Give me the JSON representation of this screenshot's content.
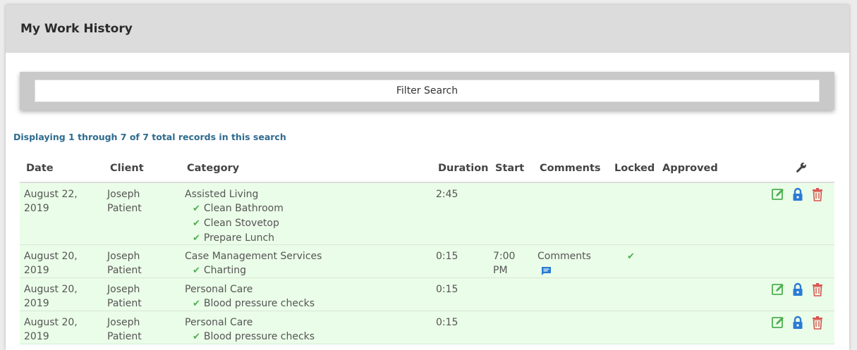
{
  "header": {
    "title": "My Work History"
  },
  "filter": {
    "label": "Filter Search"
  },
  "records_info": "Displaying 1 through 7 of 7 total records in this search",
  "columns": {
    "date": "Date",
    "client": "Client",
    "category": "Category",
    "duration": "Duration",
    "start": "Start",
    "comments": "Comments",
    "locked": "Locked",
    "approved": "Approved",
    "tools_icon": "wrench-icon"
  },
  "rows": [
    {
      "date_line1": "August 22,",
      "date_line2": "2019",
      "client_line1": "Joseph",
      "client_line2": "Patient",
      "category": "Assisted Living",
      "subitems": [
        "Clean Bathroom",
        "Clean Stovetop",
        "Prepare Lunch"
      ],
      "duration": "2:45",
      "start_line1": "",
      "start_line2": "",
      "comments": "",
      "locked": false,
      "actions": true
    },
    {
      "date_line1": "August 20,",
      "date_line2": "2019",
      "client_line1": "Joseph",
      "client_line2": "Patient",
      "category": "Case Management Services",
      "subitems": [
        "Charting"
      ],
      "duration": "0:15",
      "start_line1": "7:00",
      "start_line2": "PM",
      "comments": "Comments",
      "locked": true,
      "actions": false
    },
    {
      "date_line1": "August 20,",
      "date_line2": "2019",
      "client_line1": "Joseph",
      "client_line2": "Patient",
      "category": "Personal Care",
      "subitems": [
        "Blood pressure checks"
      ],
      "duration": "0:15",
      "start_line1": "",
      "start_line2": "",
      "comments": "",
      "locked": false,
      "actions": true
    },
    {
      "date_line1": "August 20,",
      "date_line2": "2019",
      "client_line1": "Joseph",
      "client_line2": "Patient",
      "category": "Personal Care",
      "subitems": [
        "Blood pressure checks"
      ],
      "duration": "0:15",
      "start_line1": "",
      "start_line2": "",
      "comments": "",
      "locked": false,
      "actions": true
    }
  ],
  "colors": {
    "row_bg": "#eafde8",
    "check": "#4caf50",
    "edit": "#4caf50",
    "lock": "#2a7bd4",
    "delete": "#d9534f",
    "info_text": "#2e6b8e"
  }
}
